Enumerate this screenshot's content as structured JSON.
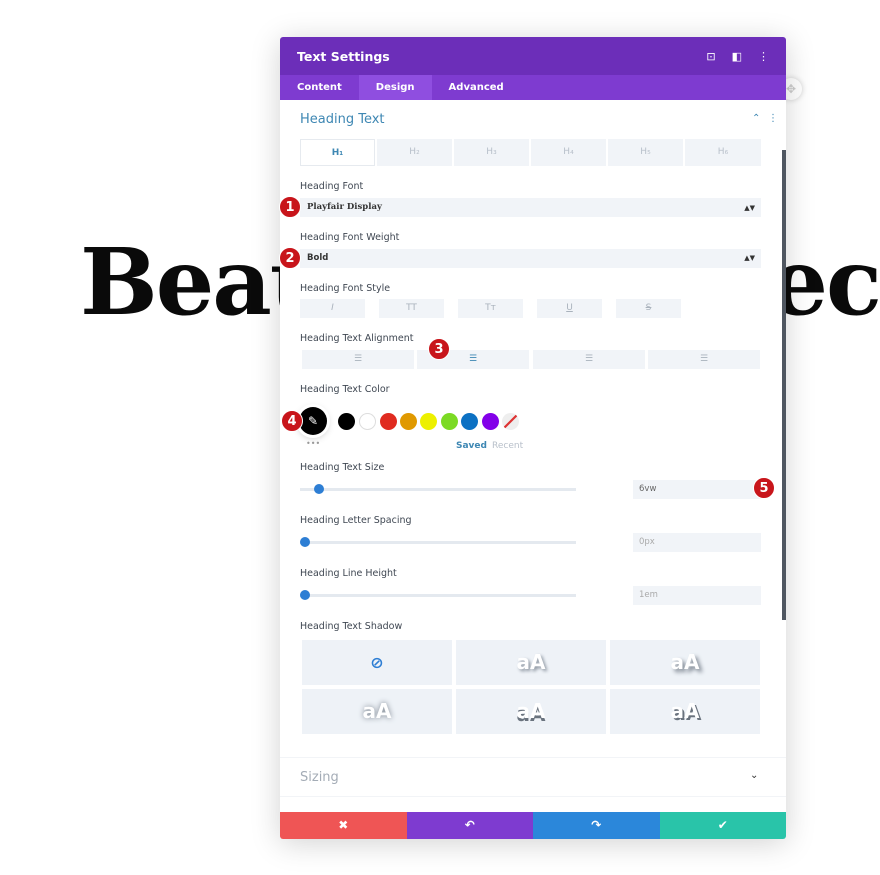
{
  "background": {
    "heading_left": "Beau",
    "heading_right": "tec"
  },
  "panel": {
    "title": "Text Settings",
    "header_icons": [
      "fullscreen-icon",
      "split-view-icon",
      "more-icon"
    ],
    "tabs": [
      {
        "label": "Content"
      },
      {
        "label": "Design",
        "active": true
      },
      {
        "label": "Advanced"
      }
    ],
    "section_title": "Heading Text",
    "heading_levels": [
      "H₁",
      "H₂",
      "H₃",
      "H₄",
      "H₅",
      "H₆"
    ],
    "active_level": "H₁",
    "font": {
      "label": "Heading Font",
      "value": "Playfair Display"
    },
    "weight": {
      "label": "Heading Font Weight",
      "value": "Bold"
    },
    "style": {
      "label": "Heading Font Style",
      "buttons": [
        "I",
        "TT",
        "Tт",
        "U",
        "S"
      ]
    },
    "alignment": {
      "label": "Heading Text Alignment",
      "options": [
        "left",
        "center",
        "right",
        "justify"
      ],
      "selected": "center"
    },
    "color": {
      "label": "Heading Text Color",
      "current": "#000000",
      "swatches": [
        "#000000",
        "#ffffff",
        "#e02b20",
        "#e09900",
        "#edf000",
        "#7cda24",
        "#0c71c3",
        "#8300e9"
      ],
      "saved_label": "Saved",
      "recent_label": "Recent",
      "more": "•••"
    },
    "size": {
      "label": "Heading Text Size",
      "value": "6vw",
      "slider_percent": 7
    },
    "letter_spacing": {
      "label": "Heading Letter Spacing",
      "value": "0px",
      "slider_percent": 0
    },
    "line_height": {
      "label": "Heading Line Height",
      "value": "1em",
      "slider_percent": 0
    },
    "shadow": {
      "label": "Heading Text Shadow",
      "preview": "aA"
    },
    "sizing": {
      "label": "Sizing"
    },
    "footer": {
      "colors": {
        "cancel": "#ef5555",
        "undo": "#7e3bd0",
        "redo": "#2b87da",
        "save": "#29c4a9"
      }
    },
    "badges": [
      "1",
      "2",
      "3",
      "4",
      "5"
    ]
  }
}
